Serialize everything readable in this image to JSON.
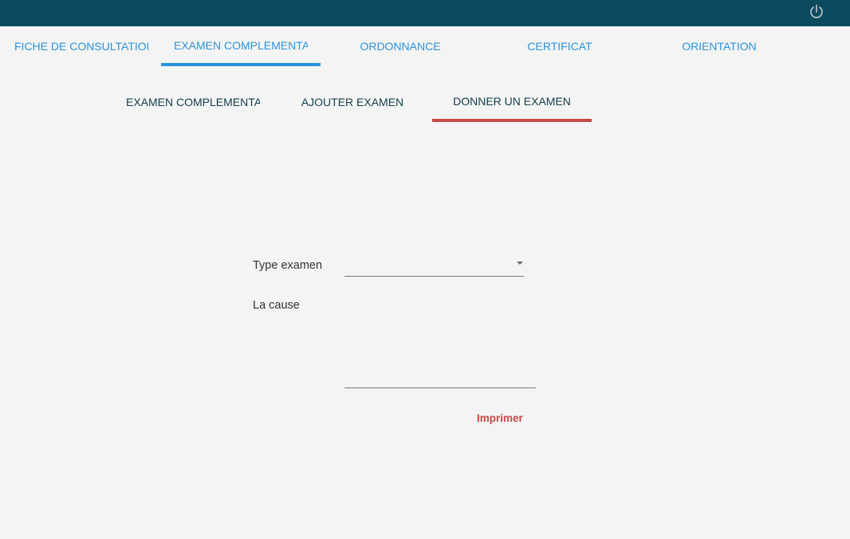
{
  "header": {
    "power_icon": "power-icon"
  },
  "main_tabs": [
    {
      "label": "FICHE DE CONSULTATION",
      "active": false
    },
    {
      "label": "EXAMEN COMPLEMENTAIRE",
      "active": true
    },
    {
      "label": "ORDONNANCE",
      "active": false
    },
    {
      "label": "CERTIFICAT",
      "active": false
    },
    {
      "label": "ORIENTATION",
      "active": false
    }
  ],
  "sub_tabs": [
    {
      "label": "EXAMEN COMPLEMENTAIRE",
      "active": false
    },
    {
      "label": "AJOUTER EXAMEN",
      "active": false
    },
    {
      "label": "DONNER UN EXAMEN",
      "active": true
    }
  ],
  "form": {
    "type_examen_label": "Type examen",
    "type_examen_value": "",
    "cause_label": "La cause",
    "cause_value": "",
    "print_label": "Imprimer"
  },
  "colors": {
    "topbar": "#0d4a5f",
    "main_tab_accent": "#2b93de",
    "sub_tab_accent": "#c94a44",
    "background": "#f4f4f4"
  }
}
